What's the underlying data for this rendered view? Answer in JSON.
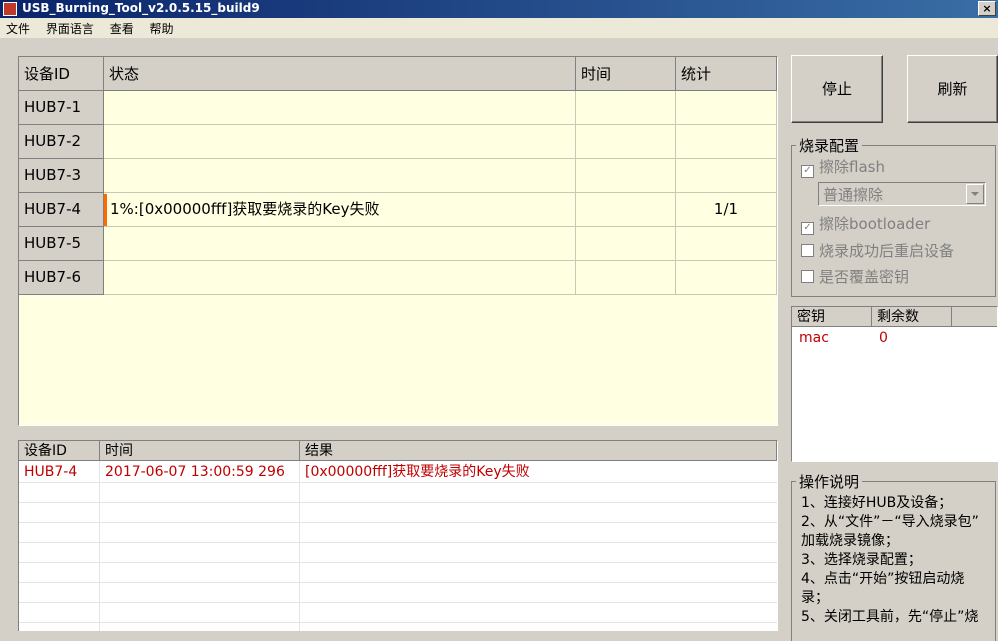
{
  "window": {
    "title": "USB_Burning_Tool_v2.0.5.15_build9",
    "close_glyph": "×"
  },
  "menu": [
    "文件",
    "界面语言",
    "查看",
    "帮助"
  ],
  "device_table": {
    "columns": [
      "设备ID",
      "状态",
      "时间",
      "统计"
    ],
    "rows": [
      {
        "id": "HUB7-1",
        "status": "",
        "time": "",
        "stats": ""
      },
      {
        "id": "HUB7-2",
        "status": "",
        "time": "",
        "stats": ""
      },
      {
        "id": "HUB7-3",
        "status": "",
        "time": "",
        "stats": ""
      },
      {
        "id": "HUB7-4",
        "status": "1%:[0x00000fff]获取要烧录的Key失败",
        "time": "",
        "stats": "1/1"
      },
      {
        "id": "HUB7-5",
        "status": "",
        "time": "",
        "stats": ""
      },
      {
        "id": "HUB7-6",
        "status": "",
        "time": "",
        "stats": ""
      }
    ]
  },
  "buttons": {
    "stop": "停止",
    "refresh": "刷新"
  },
  "burn_config": {
    "title": "烧录配置",
    "erase_flash": "擦除flash",
    "erase_mode": "普通擦除",
    "erase_bootloader": "擦除bootloader",
    "reboot_after": "烧录成功后重启设备",
    "overwrite_key": "是否覆盖密钥",
    "checked_glyph": "✓"
  },
  "key_table": {
    "columns": [
      "密钥",
      "剩余数"
    ],
    "rows": [
      {
        "key": "mac",
        "remaining": "0"
      }
    ]
  },
  "log_table": {
    "columns": [
      "设备ID",
      "时间",
      "结果"
    ],
    "rows": [
      {
        "id": "HUB7-4",
        "time": "2017-06-07 13:00:59 296",
        "result": "[0x00000fff]获取要烧录的Key失败"
      }
    ]
  },
  "instructions": {
    "title": "操作说明",
    "lines": [
      "1、连接好HUB及设备；",
      "2、从“文件”－“导入烧录包”",
      "加载烧录镜像；",
      "3、选择烧录配置；",
      "4、点击“开始”按钮启动烧",
      "录；",
      "5、关闭工具前，先“停止”烧"
    ]
  },
  "colors": {
    "accent_error": "#c00000",
    "table_bg": "#ffffe1",
    "progress_marker": "#ff6a00"
  }
}
